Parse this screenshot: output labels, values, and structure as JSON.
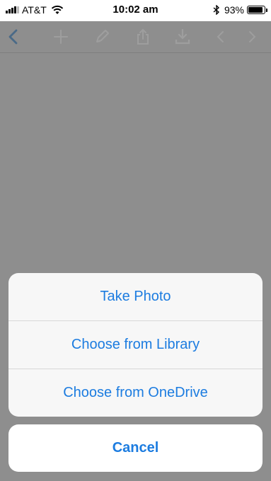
{
  "status_bar": {
    "carrier": "AT&T",
    "time": "10:02 am",
    "battery_percent": "93%",
    "battery_level": 0.93
  },
  "toolbar": {
    "icons": [
      "back-icon",
      "add-icon",
      "edit-icon",
      "share-icon",
      "download-icon",
      "previous-icon",
      "next-icon"
    ]
  },
  "action_sheet": {
    "take_photo": "Take Photo",
    "choose_library": "Choose from Library",
    "choose_onedrive": "Choose from OneDrive",
    "cancel": "Cancel"
  },
  "colors": {
    "accent": "#1c7ce0",
    "dimmed_background": "#8e8e8e"
  }
}
